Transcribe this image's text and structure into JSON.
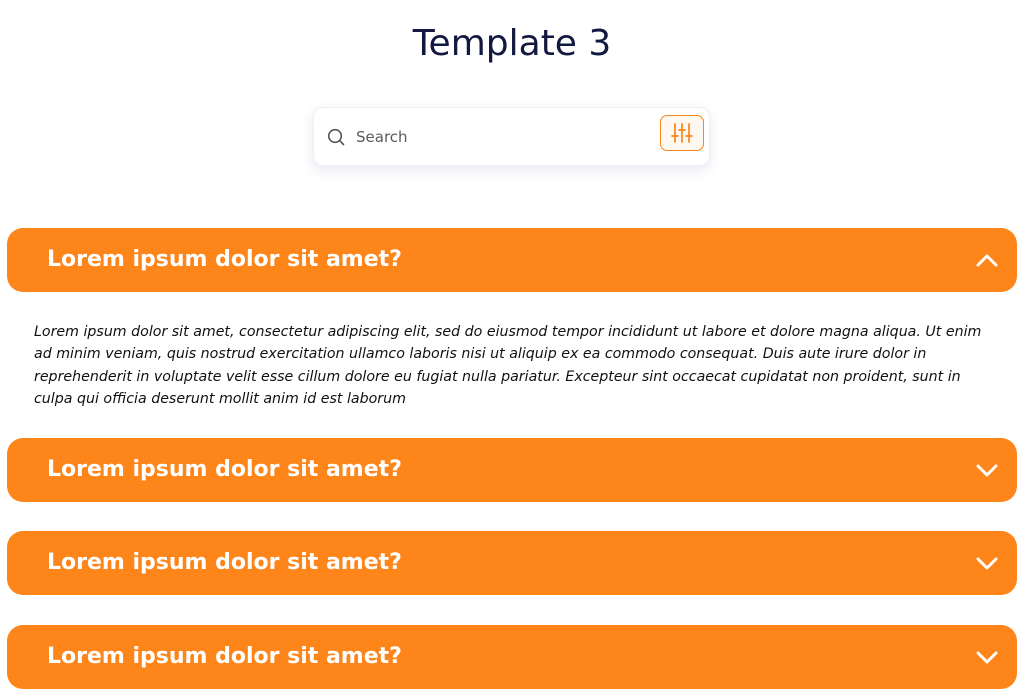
{
  "page": {
    "title": "Template 3"
  },
  "search": {
    "placeholder": "Search",
    "value": "",
    "icon": "search-icon",
    "filter_icon": "sliders-icon"
  },
  "faq": {
    "accent_color": "#fd851a",
    "items": [
      {
        "question": "Lorem ipsum dolor sit amet?",
        "expanded": true,
        "answer": "Lorem ipsum dolor sit amet, consectetur adipiscing elit, sed do eiusmod tempor incididunt ut labore et dolore magna aliqua. Ut enim ad minim veniam, quis nostrud exercitation ullamco laboris nisi ut aliquip ex ea commodo consequat. Duis aute irure dolor in reprehenderit in voluptate velit esse cillum dolore eu fugiat nulla pariatur. Excepteur sint occaecat cupidatat non proident, sunt in culpa qui officia deserunt mollit anim id est laborum"
      },
      {
        "question": "Lorem ipsum dolor sit amet?",
        "expanded": false
      },
      {
        "question": "Lorem ipsum dolor sit amet?",
        "expanded": false
      },
      {
        "question": "Lorem ipsum dolor sit amet?",
        "expanded": false
      }
    ]
  }
}
